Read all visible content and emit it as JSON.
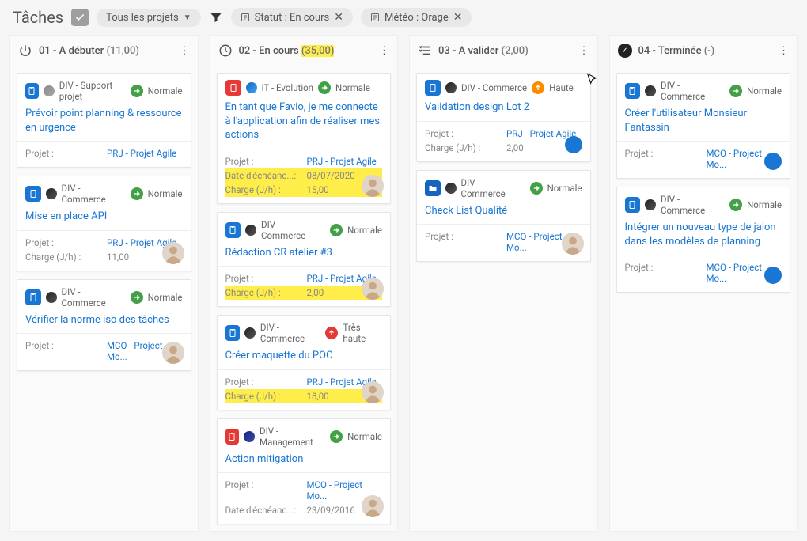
{
  "header": {
    "title": "Tâches",
    "project_filter": "Tous les projets",
    "chips": [
      {
        "icon": "filter-field",
        "label": "Statut : En cours"
      },
      {
        "icon": "filter-field",
        "label": "Météo : Orage"
      }
    ]
  },
  "columns": [
    {
      "id": "start",
      "icon": "power",
      "title": "01 - A débuter",
      "count": "(11,00)",
      "highlight_count": false,
      "cards": [
        {
          "badge": "blue",
          "dot": "gray",
          "category": "DIV - Support projet",
          "priority": "Normale",
          "priority_color": "green",
          "title": "Prévoir point planning & ressource en urgence",
          "rows": [
            {
              "label": "Projet :",
              "value": "PRJ - Projet Agile",
              "link": true
            }
          ]
        },
        {
          "badge": "blue",
          "dot": "dark",
          "category": "DIV - Commerce",
          "priority": "Normale",
          "priority_color": "green",
          "title": "Mise en place API",
          "rows": [
            {
              "label": "Projet :",
              "value": "PRJ - Projet Agile",
              "link": true
            },
            {
              "label": "Charge (J/h) :",
              "value": "11,00"
            }
          ],
          "avatar": true
        },
        {
          "badge": "blue",
          "dot": "dark",
          "category": "DIV - Commerce",
          "priority": "Normale",
          "priority_color": "green",
          "title": "Vérifier la norme iso des tâches",
          "rows": [
            {
              "label": "Projet :",
              "value": "MCO - Project Mo...",
              "link": true
            }
          ],
          "avatar": true
        }
      ]
    },
    {
      "id": "progress",
      "icon": "clock",
      "title": "02 - En cours",
      "count": "(35,00)",
      "highlight_count": true,
      "cards": [
        {
          "badge": "red",
          "dot": "blue",
          "category": "IT - Evolution",
          "priority": "Normale",
          "priority_color": "green",
          "title": "En tant que Favio, je me connecte à l'application afin de réaliser mes actions",
          "rows": [
            {
              "label": "Projet :",
              "value": "PRJ - Projet Agile",
              "link": true
            },
            {
              "label": "Date d'échéanc...:",
              "value": "08/07/2020",
              "hl": true
            },
            {
              "label": "Charge (J/h) :",
              "value": "15,00",
              "hl": true
            }
          ],
          "avatar": true
        },
        {
          "badge": "blue",
          "dot": "dark",
          "category": "DIV - Commerce",
          "priority": "Normale",
          "priority_color": "green",
          "title": "Rédaction CR atelier #3",
          "rows": [
            {
              "label": "Projet :",
              "value": "PRJ - Projet Agile",
              "link": true
            },
            {
              "label": "Charge (J/h) :",
              "value": "2,00",
              "hl": true
            }
          ],
          "avatar": true
        },
        {
          "badge": "blue",
          "dot": "dark",
          "category": "DIV - Commerce",
          "priority": "Très haute",
          "priority_color": "red",
          "title": "Créer maquette du POC",
          "rows": [
            {
              "label": "Projet :",
              "value": "PRJ - Projet Agile",
              "link": true
            },
            {
              "label": "Charge (J/h) :",
              "value": "18,00",
              "hl": true
            }
          ],
          "avatar": true
        },
        {
          "badge": "red",
          "dot": "navy",
          "category": "DIV - Management",
          "priority": "Normale",
          "priority_color": "green",
          "title": "Action mitigation",
          "rows": [
            {
              "label": "Projet :",
              "value": "MCO - Project Mo...",
              "link": true
            },
            {
              "label": "Date d'échéanc...:",
              "value": "23/09/2016"
            }
          ],
          "avatar": true
        }
      ]
    },
    {
      "id": "validate",
      "icon": "checklist",
      "title": "03 - A valider",
      "count": "(2,00)",
      "highlight_count": false,
      "cards": [
        {
          "badge": "blue",
          "dot": "dark",
          "category": "DIV - Commerce",
          "priority": "Haute",
          "priority_color": "orange",
          "title": "Validation design Lot 2",
          "rows": [
            {
              "label": "Projet :",
              "value": "PRJ - Projet Agile",
              "link": true
            },
            {
              "label": "Charge (J/h) :",
              "value": "2,00"
            }
          ],
          "marker": true
        },
        {
          "badge": "folder",
          "dot": "dark",
          "category": "DIV - Commerce",
          "priority": "Normale",
          "priority_color": "green",
          "title": "Check List Qualité",
          "rows": [
            {
              "label": "Projet :",
              "value": "MCO - Project Mo...",
              "link": true
            }
          ],
          "avatar": true
        }
      ]
    },
    {
      "id": "done",
      "icon": "done",
      "title": "04 - Terminée",
      "count": "(-)",
      "highlight_count": false,
      "cards": [
        {
          "badge": "blue",
          "dot": "dark",
          "category": "DIV - Commerce",
          "priority": "Normale",
          "priority_color": "green",
          "title": "Créer l'utilisateur Monsieur Fantassin",
          "rows": [
            {
              "label": "Projet :",
              "value": "MCO - Project Mo...",
              "link": true
            }
          ],
          "marker": true
        },
        {
          "badge": "blue",
          "dot": "dark",
          "category": "DIV - Commerce",
          "priority": "Normale",
          "priority_color": "green",
          "title": "Intégrer un nouveau type de jalon dans les modèles de planning",
          "rows": [
            {
              "label": "Projet :",
              "value": "MCO - Project Mo...",
              "link": true
            }
          ],
          "marker": true
        }
      ]
    }
  ]
}
